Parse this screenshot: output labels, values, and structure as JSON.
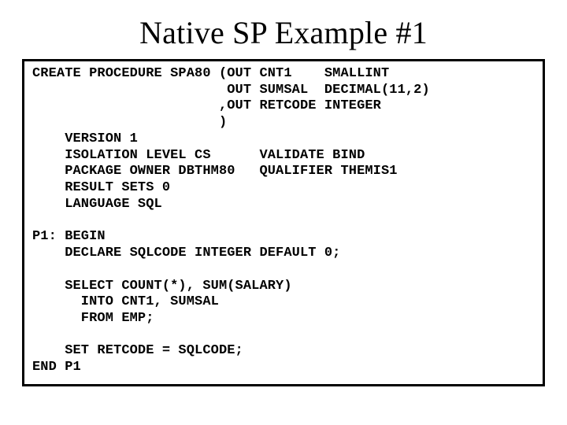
{
  "title": "Native SP Example #1",
  "code": {
    "l01": "CREATE PROCEDURE SPA80 (OUT CNT1    SMALLINT",
    "l02": "                        OUT SUMSAL  DECIMAL(11,2)",
    "l03": "                       ,OUT RETCODE INTEGER",
    "l04": "                       )",
    "l05": "    VERSION 1",
    "l06": "    ISOLATION LEVEL CS      VALIDATE BIND",
    "l07": "    PACKAGE OWNER DBTHM80   QUALIFIER THEMIS1",
    "l08": "    RESULT SETS 0",
    "l09": "    LANGUAGE SQL",
    "l10": "",
    "l11": "P1: BEGIN",
    "l12": "    DECLARE SQLCODE INTEGER DEFAULT 0;",
    "l13": "",
    "l14": "    SELECT COUNT(*), SUM(SALARY)",
    "l15": "      INTO CNT1, SUMSAL",
    "l16": "      FROM EMP;",
    "l17": "",
    "l18": "    SET RETCODE = SQLCODE;",
    "l19": "END P1"
  }
}
